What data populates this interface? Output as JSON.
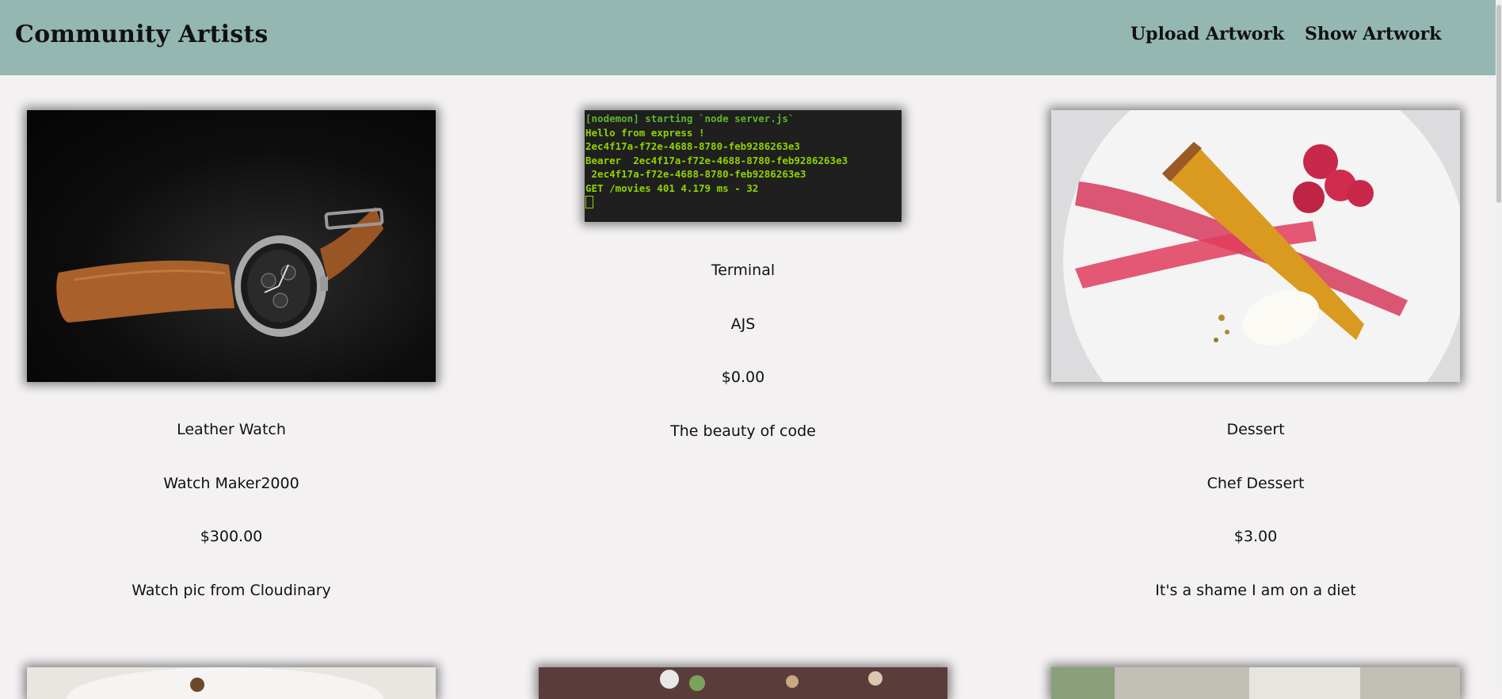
{
  "app": {
    "brand": "Community Artists"
  },
  "nav": {
    "upload_label": "Upload Artwork",
    "show_label": "Show Artwork"
  },
  "artworks": [
    {
      "title": "Leather Watch",
      "artist": "Watch Maker2000",
      "price": "$300.00",
      "description": "Watch pic from Cloudinary",
      "image": "leather-watch-photo"
    },
    {
      "title": "Terminal",
      "artist": "AJS",
      "price": "$0.00",
      "description": "The beauty of code",
      "image": "terminal-screenshot",
      "terminal_lines": [
        "[nodemon] starting `node server.js`",
        "Hello from express !",
        "2ec4f17a-f72e-4688-8780-feb9286263e3",
        "Bearer  2ec4f17a-f72e-4688-8780-feb9286263e3",
        " 2ec4f17a-f72e-4688-8780-feb9286263e3",
        "GET /movies 401 4.179 ms - 32"
      ]
    },
    {
      "title": "Dessert",
      "artist": "Chef Dessert",
      "price": "$3.00",
      "description": "It's a shame I am on a diet",
      "image": "dessert-photo"
    }
  ],
  "colors": {
    "navbar": "#94b8b1",
    "page_bg": "#f3f1f2",
    "terminal_text": "#8fd400"
  }
}
